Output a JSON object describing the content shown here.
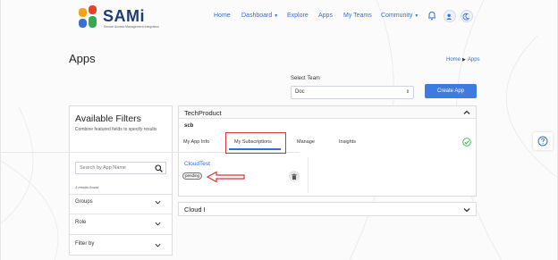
{
  "header": {
    "logo_text": "SAMi",
    "logo_tagline": "Secure Access Management Integration",
    "nav": [
      {
        "label": "Home",
        "dropdown": false
      },
      {
        "label": "Dashboard",
        "dropdown": true
      },
      {
        "label": "Explore",
        "dropdown": false
      },
      {
        "label": "Apps",
        "dropdown": false
      },
      {
        "label": "My Teams",
        "dropdown": false
      },
      {
        "label": "Community",
        "dropdown": true
      }
    ],
    "icons": [
      "bell-icon",
      "user-icon",
      "moon-icon"
    ]
  },
  "page": {
    "title": "Apps",
    "breadcrumb": [
      "Home",
      "Apps"
    ]
  },
  "team": {
    "label": "Select Team",
    "selected": "Doc",
    "create_button": "Create App"
  },
  "filters": {
    "title": "Available Filters",
    "subtitle": "Combine featured fields to specify results",
    "search_placeholder": "Search by App Name",
    "results": "3 results found",
    "facets": [
      "Groups",
      "Role",
      "Filter by"
    ]
  },
  "panel": {
    "title": "TechProduct",
    "team_code": "scb",
    "tabs": [
      "My App Info",
      "My Subscriptions",
      "Manage",
      "Insights"
    ],
    "active_tab": "My Subscriptions",
    "subscription": {
      "name": "CloudTest",
      "status": "pending"
    }
  },
  "panel2": {
    "title": "Cloud I"
  },
  "colors": {
    "accent": "#2f6fd6",
    "primary_button": "#3d7be0",
    "annotation_red": "#d93434",
    "success_green": "#34b34a"
  }
}
